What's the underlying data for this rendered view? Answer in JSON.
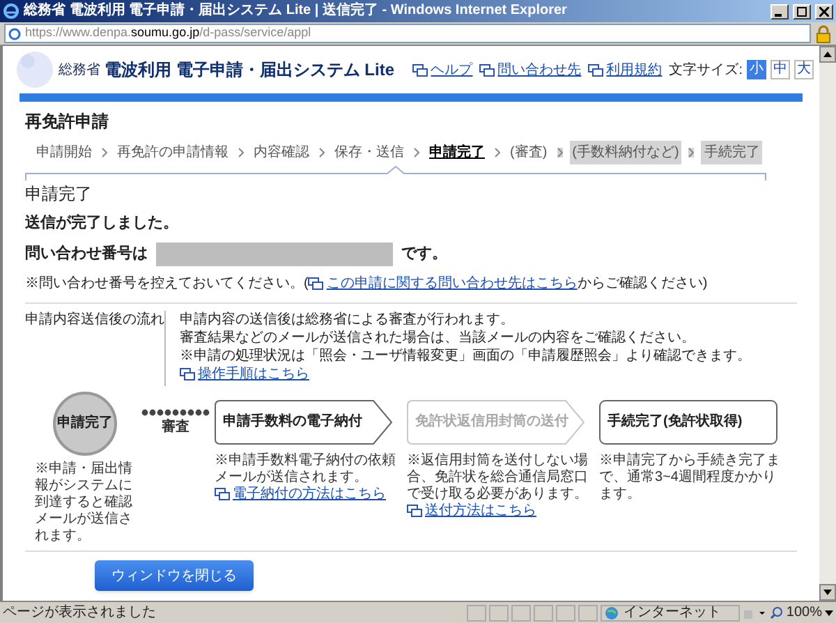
{
  "window": {
    "title": "総務省 電波利用 電子申請・届出システム Lite | 送信完了 - Windows Internet Explorer",
    "url_prefix": "https://www.denpa.",
    "url_domain": "soumu.go.jp",
    "url_path": "/d-pass/service/appl"
  },
  "header": {
    "ministry": "総務省",
    "system_name": "電波利用 電子申請・届出システム Lite",
    "links": [
      "ヘルプ",
      "問い合わせ先",
      "利用規約"
    ],
    "font_size_label": "文字サイズ:",
    "font_sizes": [
      {
        "label": "小",
        "selected": true
      },
      {
        "label": "中",
        "selected": false
      },
      {
        "label": "大",
        "selected": false
      }
    ]
  },
  "page_title": "再免許申請",
  "breadcrumb": [
    {
      "label": "申請開始",
      "selected": false,
      "shaded": false
    },
    {
      "label": "再免許の申請情報",
      "selected": false,
      "shaded": false
    },
    {
      "label": "内容確認",
      "selected": false,
      "shaded": false
    },
    {
      "label": "保存・送信",
      "selected": false,
      "shaded": false
    },
    {
      "label": "申請完了",
      "selected": true,
      "shaded": false
    },
    {
      "label": "(審査)",
      "selected": false,
      "shaded": false
    },
    {
      "label": "(手数料納付など)",
      "selected": false,
      "shaded": true
    },
    {
      "label": "手続完了",
      "selected": false,
      "shaded": true
    }
  ],
  "section_title": "申請完了",
  "message": "送信が完了しました。",
  "inquiry_label": "問い合わせ番号は",
  "inquiry_suffix": "です。",
  "inquiry_note_before": "※問い合わせ番号を控えておいてください。(",
  "inquiry_note_link": "この申請に関する問い合わせ先はこちら",
  "inquiry_note_after": "からご確認ください)",
  "flow_label": "申請内容送信後の流れ",
  "flow_lines": [
    "申請内容の送信後は総務省による審査が行われます。",
    "審査結果などのメールが送信された場合は、当該メールの内容をご確認ください。",
    "※申請の処理状況は「照会・ユーザ情報変更」画面の「申請履歴照会」より確認できます。"
  ],
  "flow_link": "操作手順はこちら",
  "flow_steps": [
    {
      "kind": "circle",
      "label": "申請完了",
      "disabled": false,
      "note": "※申請・届出情報がシステムに到達すると確認メールが送信されます。"
    },
    {
      "kind": "dots",
      "label": "審査",
      "disabled": false
    },
    {
      "kind": "arrow",
      "label": "申請手数料の電子納付",
      "disabled": false,
      "note": "※申請手数料電子納付の依頼メールが送信されます。",
      "link": "電子納付の方法はこちら"
    },
    {
      "kind": "arrow",
      "label": "免許状返信用封筒の送付",
      "disabled": true,
      "note": "※返信用封筒を送付しない場合、免許状を総合通信局窓口で受け取る必要があります。",
      "link": "送付方法はこちら"
    },
    {
      "kind": "end",
      "label": "手続完了(免許状取得)",
      "disabled": false,
      "note": "※申請完了から手続き完了まで、通常3~4週間程度かかります。"
    }
  ],
  "close_button": "ウィンドウを閉じる",
  "status_bar": {
    "text": "ページが表示されました",
    "zone": "インターネット",
    "zoom": "100%"
  }
}
